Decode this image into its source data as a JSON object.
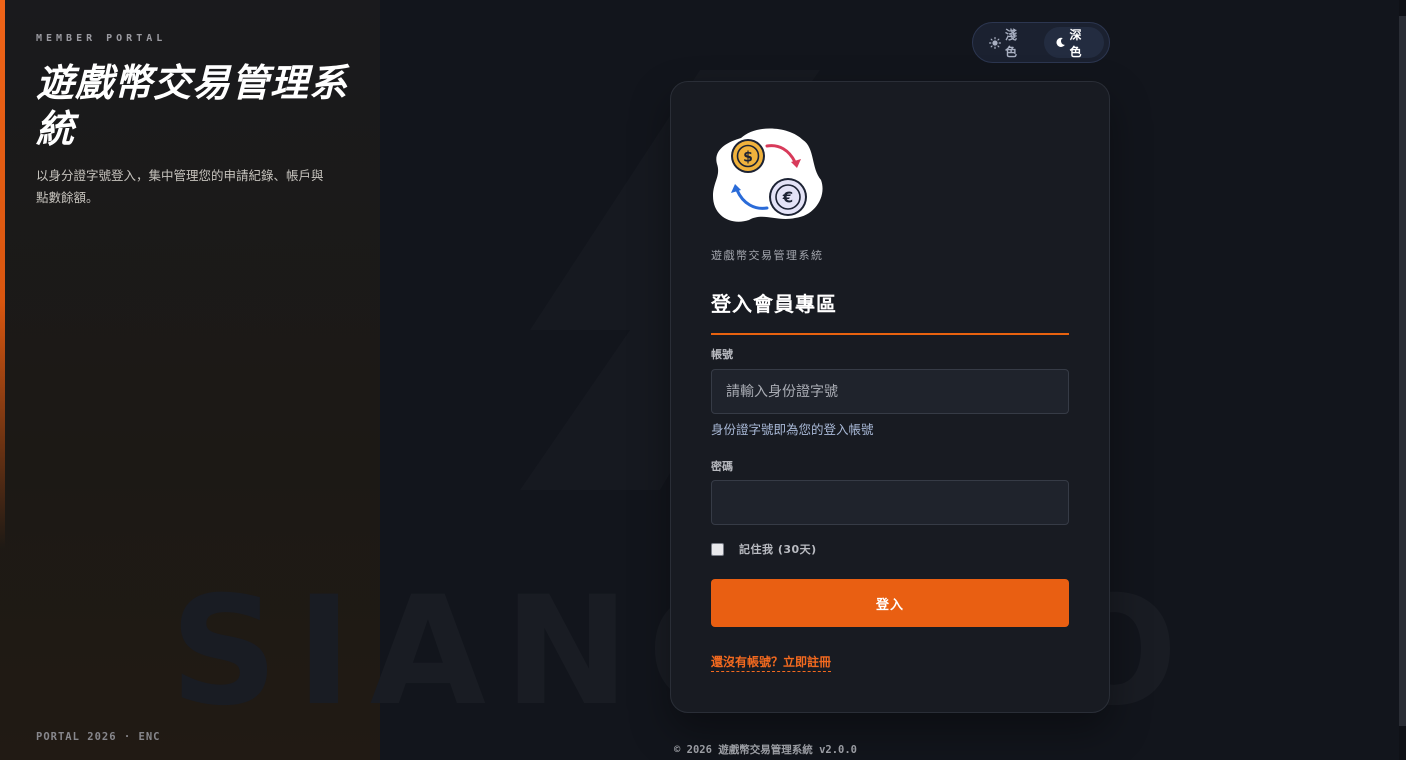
{
  "sidebar": {
    "eyebrow": "MEMBER PORTAL",
    "title": "遊戲幣交易管理系統",
    "description": "以身分證字號登入，集中管理您的申請紀錄、帳戶與點數餘額。",
    "footer": "PORTAL 2026 · ENC",
    "accent_color": "#e8620f"
  },
  "watermark": {
    "text": "SIANGPRO"
  },
  "theme_toggle": {
    "light_label": "淺色",
    "light_icon": "sun-icon",
    "dark_label": "深色",
    "dark_icon": "moon-icon",
    "active": "dark"
  },
  "login_card": {
    "logo_icon": "currency-exchange-icon",
    "subtitle": "遊戲幣交易管理系統",
    "heading": "登入會員專區",
    "account": {
      "label": "帳號",
      "placeholder": "請輸入身份證字號",
      "value": "",
      "hint": "身份證字號即為您的登入帳號"
    },
    "password": {
      "label": "密碼",
      "value": ""
    },
    "remember": {
      "label": "記住我 (30天)",
      "checked": false
    },
    "submit_label": "登入",
    "register_link": "還沒有帳號？立即註冊",
    "button_color": "#e95f12"
  },
  "footer": {
    "copyright": "© 2026 遊戲幣交易管理系統 v2.0.0"
  }
}
